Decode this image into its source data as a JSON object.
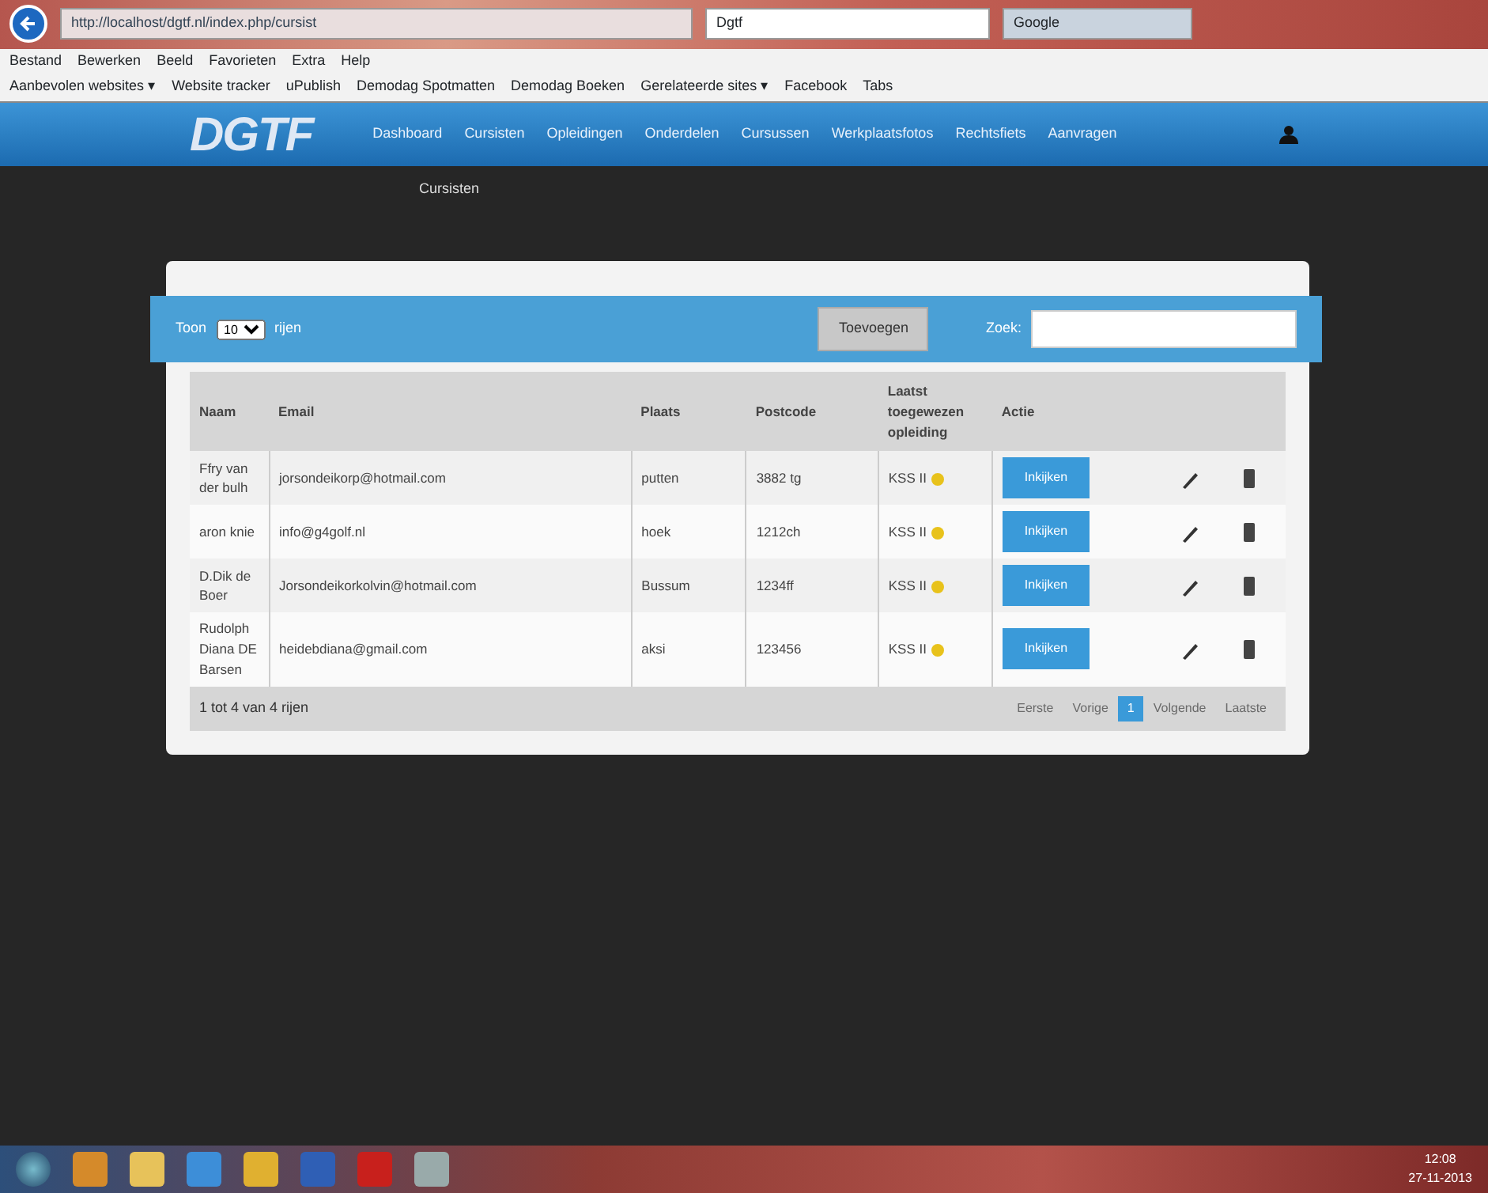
{
  "browser": {
    "address": "http://localhost/dgtf.nl/index.php/cursist",
    "tabs": [
      {
        "label": "Dgtf",
        "selected": true
      },
      {
        "label": "Google",
        "selected": false
      }
    ],
    "menu": [
      "Bestand",
      "Bewerken",
      "Beeld",
      "Favorieten",
      "Extra",
      "Help"
    ],
    "favorites": [
      "Aanbevolen websites ▾",
      "Website tracker",
      "uPublish",
      "Demodag Spotmatten",
      "Demodag Boeken",
      "Gerelateerde sites ▾",
      "Facebook",
      "Tabs"
    ]
  },
  "app": {
    "logo": "DGTF",
    "nav": [
      "Dashboard",
      "Cursisten",
      "Opleidingen",
      "Onderdelen",
      "Cursussen",
      "Werkplaatsfotos",
      "Rechtsfiets",
      "Aanvragen"
    ],
    "subnav": "Cursisten",
    "toolbar": {
      "show_before": "Toon",
      "length": "10",
      "show_after": "rijen",
      "add_button": "Toevoegen",
      "search_label": "Zoek:"
    },
    "table": {
      "columns": [
        "Naam",
        "Email",
        "Plaats",
        "Postcode",
        "Laatst toegewezen opleiding",
        "Actie"
      ],
      "rows": [
        {
          "naam": "Ffry van der bulh",
          "email": "jorsondeikorp@hotmail.com",
          "plaats": "putten",
          "postcode": "3882 tg",
          "opleiding": "KSS II",
          "action": "Inkijken"
        },
        {
          "naam": "aron knie",
          "email": "info@g4golf.nl",
          "plaats": "hoek",
          "postcode": "1212ch",
          "opleiding": "KSS II",
          "action": "Inkijken"
        },
        {
          "naam": "D.Dik de Boer",
          "email": "Jorsondeikorkolvin@hotmail.com",
          "plaats": "Bussum",
          "postcode": "1234ff",
          "opleiding": "KSS II",
          "action": "Inkijken"
        },
        {
          "naam": "Rudolph Diana DE Barsen",
          "email": "heidebdiana@gmail.com",
          "plaats": "aksi",
          "postcode": "123456",
          "opleiding": "KSS II",
          "action": "Inkijken"
        }
      ]
    },
    "info": "1 tot 4 van 4 rijen",
    "pagination": [
      {
        "label": "Eerste",
        "selected": false
      },
      {
        "label": "Vorige",
        "selected": false
      },
      {
        "label": "1",
        "selected": true
      },
      {
        "label": "Volgende",
        "selected": false
      },
      {
        "label": "Laatste",
        "selected": false
      }
    ]
  },
  "taskbar": {
    "time": "12:08",
    "date": "27-11-2013"
  }
}
